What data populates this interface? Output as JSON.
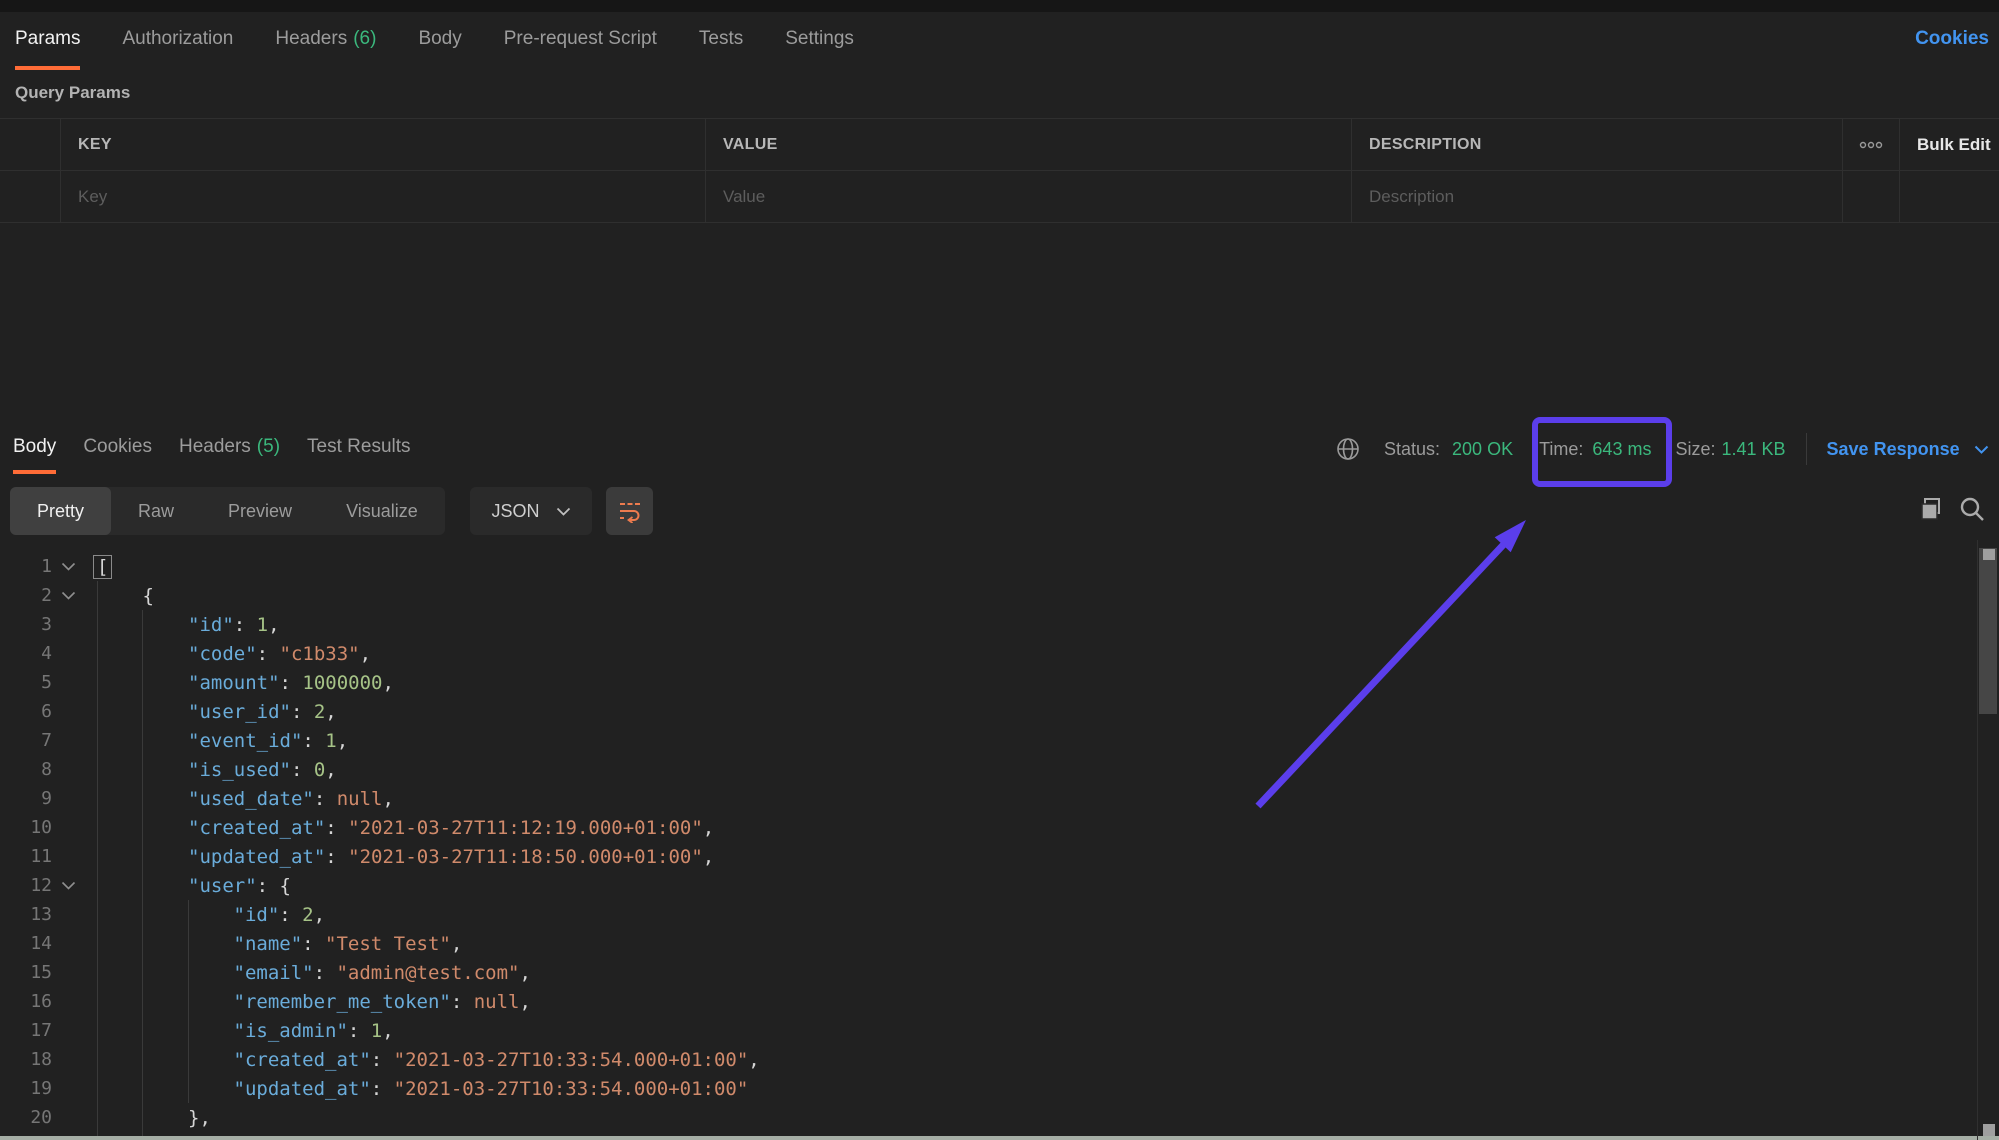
{
  "topbar": {
    "tabs": [
      {
        "label": "Params",
        "active": true
      },
      {
        "label": "Authorization"
      },
      {
        "label": "Headers",
        "count": "(6)"
      },
      {
        "label": "Body"
      },
      {
        "label": "Pre-request Script"
      },
      {
        "label": "Tests"
      },
      {
        "label": "Settings"
      }
    ],
    "cookies_link": "Cookies"
  },
  "query_params": {
    "title": "Query Params",
    "columns": [
      "KEY",
      "VALUE",
      "DESCRIPTION"
    ],
    "placeholders": [
      "Key",
      "Value",
      "Description"
    ],
    "bulk_edit_label": "Bulk Edit",
    "more_icon": "more-actions-icon"
  },
  "response": {
    "tabs": [
      {
        "label": "Body",
        "active": true
      },
      {
        "label": "Cookies"
      },
      {
        "label": "Headers",
        "count": "(5)"
      },
      {
        "label": "Test Results"
      }
    ],
    "status_label": "Status:",
    "status_value": "200 OK",
    "time_label": "Time:",
    "time_value": "643 ms",
    "size_label": "Size:",
    "size_value": "1.41 KB",
    "save_label": "Save Response",
    "globe_icon": "globe-icon"
  },
  "viewer": {
    "modes": [
      "Pretty",
      "Raw",
      "Preview",
      "Visualize"
    ],
    "active_mode": "Pretty",
    "format": "JSON",
    "wrap_icon": "wrap-line-icon",
    "copy_icon": "copy-icon",
    "search_icon": "search-icon"
  },
  "annotation": {
    "type": "arrow-and-box",
    "color": "#5b3eeb",
    "target": "response-time-badge"
  },
  "colors": {
    "accent_orange": "#ff6c37",
    "green": "#3bb87d",
    "blue": "#4294f0",
    "purple": "#5b3eeb",
    "json_key": "#6aacda",
    "json_string": "#d08a6b",
    "json_number": "#a6c387",
    "json_null": "#d08a6b"
  },
  "code": {
    "lines": [
      {
        "n": 1,
        "lvl": 0,
        "chev": true,
        "tokens": [
          {
            "t": "brk",
            "v": "["
          }
        ]
      },
      {
        "n": 2,
        "lvl": 1,
        "chev": true,
        "tokens": [
          {
            "t": "punc",
            "v": "{"
          }
        ]
      },
      {
        "n": 3,
        "lvl": 2,
        "tokens": [
          {
            "t": "key",
            "v": "id"
          },
          {
            "t": "punc",
            "v": ": "
          },
          {
            "t": "num",
            "v": "1"
          },
          {
            "t": "punc",
            "v": ","
          }
        ]
      },
      {
        "n": 4,
        "lvl": 2,
        "tokens": [
          {
            "t": "key",
            "v": "code"
          },
          {
            "t": "punc",
            "v": ": "
          },
          {
            "t": "str",
            "v": "c1b33"
          },
          {
            "t": "punc",
            "v": ","
          }
        ]
      },
      {
        "n": 5,
        "lvl": 2,
        "tokens": [
          {
            "t": "key",
            "v": "amount"
          },
          {
            "t": "punc",
            "v": ": "
          },
          {
            "t": "num",
            "v": "1000000"
          },
          {
            "t": "punc",
            "v": ","
          }
        ]
      },
      {
        "n": 6,
        "lvl": 2,
        "tokens": [
          {
            "t": "key",
            "v": "user_id"
          },
          {
            "t": "punc",
            "v": ": "
          },
          {
            "t": "num",
            "v": "2"
          },
          {
            "t": "punc",
            "v": ","
          }
        ]
      },
      {
        "n": 7,
        "lvl": 2,
        "tokens": [
          {
            "t": "key",
            "v": "event_id"
          },
          {
            "t": "punc",
            "v": ": "
          },
          {
            "t": "num",
            "v": "1"
          },
          {
            "t": "punc",
            "v": ","
          }
        ]
      },
      {
        "n": 8,
        "lvl": 2,
        "tokens": [
          {
            "t": "key",
            "v": "is_used"
          },
          {
            "t": "punc",
            "v": ": "
          },
          {
            "t": "num",
            "v": "0"
          },
          {
            "t": "punc",
            "v": ","
          }
        ]
      },
      {
        "n": 9,
        "lvl": 2,
        "tokens": [
          {
            "t": "key",
            "v": "used_date"
          },
          {
            "t": "punc",
            "v": ": "
          },
          {
            "t": "nul",
            "v": "null"
          },
          {
            "t": "punc",
            "v": ","
          }
        ]
      },
      {
        "n": 10,
        "lvl": 2,
        "tokens": [
          {
            "t": "key",
            "v": "created_at"
          },
          {
            "t": "punc",
            "v": ": "
          },
          {
            "t": "str",
            "v": "2021-03-27T11:12:19.000+01:00"
          },
          {
            "t": "punc",
            "v": ","
          }
        ]
      },
      {
        "n": 11,
        "lvl": 2,
        "tokens": [
          {
            "t": "key",
            "v": "updated_at"
          },
          {
            "t": "punc",
            "v": ": "
          },
          {
            "t": "str",
            "v": "2021-03-27T11:18:50.000+01:00"
          },
          {
            "t": "punc",
            "v": ","
          }
        ]
      },
      {
        "n": 12,
        "lvl": 2,
        "chev": true,
        "tokens": [
          {
            "t": "key",
            "v": "user"
          },
          {
            "t": "punc",
            "v": ": "
          },
          {
            "t": "punc",
            "v": "{"
          }
        ]
      },
      {
        "n": 13,
        "lvl": 3,
        "tokens": [
          {
            "t": "key",
            "v": "id"
          },
          {
            "t": "punc",
            "v": ": "
          },
          {
            "t": "num",
            "v": "2"
          },
          {
            "t": "punc",
            "v": ","
          }
        ]
      },
      {
        "n": 14,
        "lvl": 3,
        "tokens": [
          {
            "t": "key",
            "v": "name"
          },
          {
            "t": "punc",
            "v": ": "
          },
          {
            "t": "str",
            "v": "Test Test"
          },
          {
            "t": "punc",
            "v": ","
          }
        ]
      },
      {
        "n": 15,
        "lvl": 3,
        "tokens": [
          {
            "t": "key",
            "v": "email"
          },
          {
            "t": "punc",
            "v": ": "
          },
          {
            "t": "str",
            "v": "admin@test.com"
          },
          {
            "t": "punc",
            "v": ","
          }
        ]
      },
      {
        "n": 16,
        "lvl": 3,
        "tokens": [
          {
            "t": "key",
            "v": "remember_me_token"
          },
          {
            "t": "punc",
            "v": ": "
          },
          {
            "t": "nul",
            "v": "null"
          },
          {
            "t": "punc",
            "v": ","
          }
        ]
      },
      {
        "n": 17,
        "lvl": 3,
        "tokens": [
          {
            "t": "key",
            "v": "is_admin"
          },
          {
            "t": "punc",
            "v": ": "
          },
          {
            "t": "num",
            "v": "1"
          },
          {
            "t": "punc",
            "v": ","
          }
        ]
      },
      {
        "n": 18,
        "lvl": 3,
        "tokens": [
          {
            "t": "key",
            "v": "created_at"
          },
          {
            "t": "punc",
            "v": ": "
          },
          {
            "t": "str",
            "v": "2021-03-27T10:33:54.000+01:00"
          },
          {
            "t": "punc",
            "v": ","
          }
        ]
      },
      {
        "n": 19,
        "lvl": 3,
        "tokens": [
          {
            "t": "key",
            "v": "updated_at"
          },
          {
            "t": "punc",
            "v": ": "
          },
          {
            "t": "str",
            "v": "2021-03-27T10:33:54.000+01:00"
          }
        ]
      },
      {
        "n": 20,
        "lvl": 2,
        "tokens": [
          {
            "t": "punc",
            "v": "},"
          }
        ]
      }
    ]
  }
}
